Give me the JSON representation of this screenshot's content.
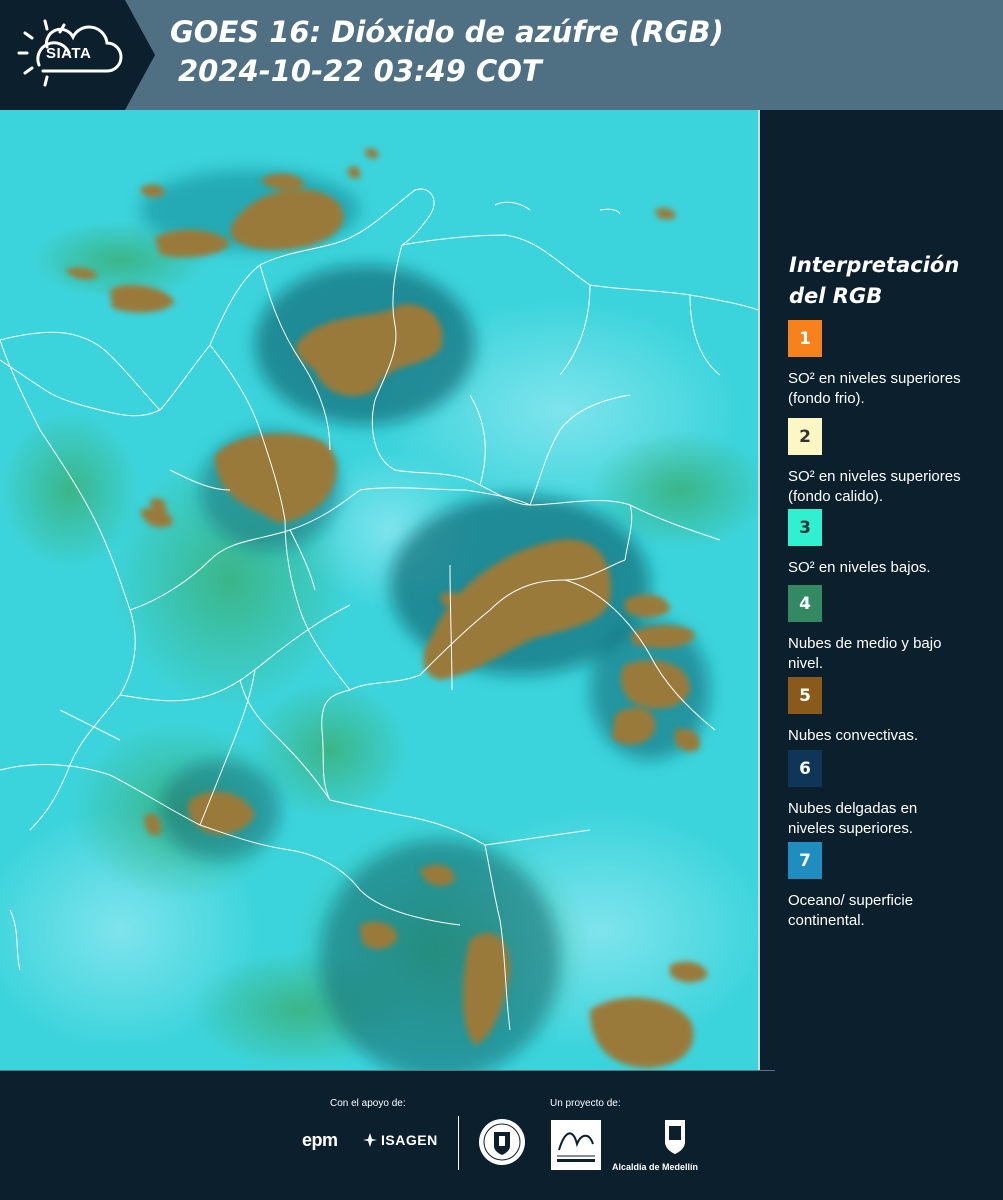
{
  "header": {
    "logo_text": "SIATA",
    "title_line1": "GOES 16: Dióxido de azúfre (RGB)",
    "title_line2": "2024-10-22 03:49 COT"
  },
  "legend": {
    "title_line1": "Interpretación",
    "title_line2": "del RGB",
    "items": [
      {
        "number": "1",
        "color": "#f7821b",
        "text_color": "#ffffff",
        "label": "SO² en niveles superiores (fondo frio)."
      },
      {
        "number": "2",
        "color": "#fdf7c5",
        "text_color": "#333333",
        "label": "SO² en niveles superiores (fondo calido)."
      },
      {
        "number": "3",
        "color": "#2ff1d0",
        "text_color": "#333333",
        "label": "SO² en niveles bajos."
      },
      {
        "number": "4",
        "color": "#338a62",
        "text_color": "#ffffff",
        "label": "Nubes de medio y bajo nivel."
      },
      {
        "number": "5",
        "color": "#8a5a1a",
        "text_color": "#ffffff",
        "label": "Nubes convectivas."
      },
      {
        "number": "6",
        "color": "#0f3559",
        "text_color": "#ffffff",
        "label": "Nubes delgadas en niveles superiores."
      },
      {
        "number": "7",
        "color": "#1f8dbf",
        "text_color": "#ffffff",
        "label": "Oceano/ superficie continental."
      }
    ]
  },
  "footer": {
    "support_label": "Con el apoyo de:",
    "project_label": "Un proyecto de:",
    "sponsor_1": "epm",
    "sponsor_2": "ISAGEN",
    "partner_1": "Área Metropolitana Valle de Aburrá",
    "partner_2": "Alcaldía de Medellín"
  },
  "colors": {
    "header_bg": "#4f6f82",
    "panel_bg": "#0b1f2c",
    "map_background": "#3fd6dc",
    "convective_cloud": "#9a7a3a"
  }
}
